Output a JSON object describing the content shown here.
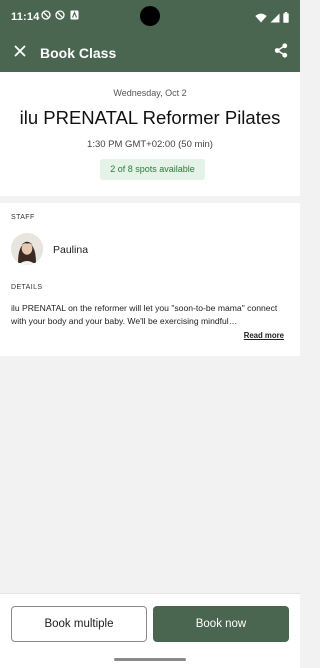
{
  "status_bar": {
    "time": "11:14",
    "icons": [
      "do-not-disturb-icon",
      "do-not-disturb-icon",
      "app-notification-icon",
      "wifi-icon",
      "signal-icon",
      "battery-icon"
    ]
  },
  "app_bar": {
    "title": "Book Class",
    "icons": {
      "close": "close-icon",
      "share": "share-icon"
    }
  },
  "class_info": {
    "date": "Wednesday, Oct 2",
    "title": "ilu PRENATAL Reformer Pilates",
    "time": "1:30 PM GMT+02:00 (50 min)",
    "availability": "2 of 8 spots available"
  },
  "staff": {
    "section_label": "STAFF",
    "name": "Paulina"
  },
  "details": {
    "section_label": "DETAILS",
    "text": "ilu PRENATAL on the reformer will let you \"soon-to-be mama\" connect with your body and your baby. We'll be exercising mindful…",
    "read_more_label": "Read more"
  },
  "actions": {
    "book_multiple_label": "Book multiple",
    "book_now_label": "Book now"
  },
  "colors": {
    "primary": "#4a6650",
    "availability_bg": "#e5f2e7",
    "availability_text": "#2d7a3c",
    "page_bg": "#f2f2f2"
  }
}
